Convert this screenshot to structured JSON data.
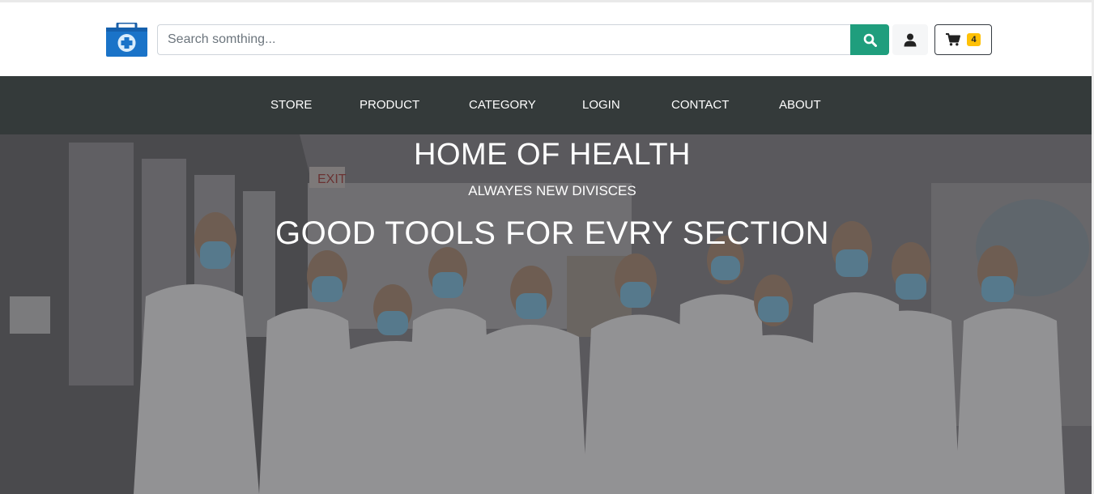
{
  "header": {
    "logo_icon": "medical-kit-icon",
    "search": {
      "placeholder": "Search somthing...",
      "value": "",
      "button_icon": "search-icon"
    },
    "user_icon": "user-icon",
    "cart": {
      "icon": "cart-icon",
      "count": "4"
    }
  },
  "nav": {
    "items": [
      {
        "label": "STORE"
      },
      {
        "label": "PRODUCT"
      },
      {
        "label": "CATEGORY"
      },
      {
        "label": "LOGIN"
      },
      {
        "label": "CONTACT"
      },
      {
        "label": "ABOUT"
      }
    ]
  },
  "hero": {
    "title": "HOME OF HEALTH",
    "subtitle": "ALWAYES NEW DIVISCES",
    "tagline": "GOOD TOOLS FOR EVRY SECTION",
    "image": "group of medical staff in white lab coats and face masks"
  },
  "colors": {
    "accent": "#1f9e7d",
    "nav_bg": "#343a3a",
    "badge": "#ffc107",
    "logo_blue": "#1a73c8"
  }
}
